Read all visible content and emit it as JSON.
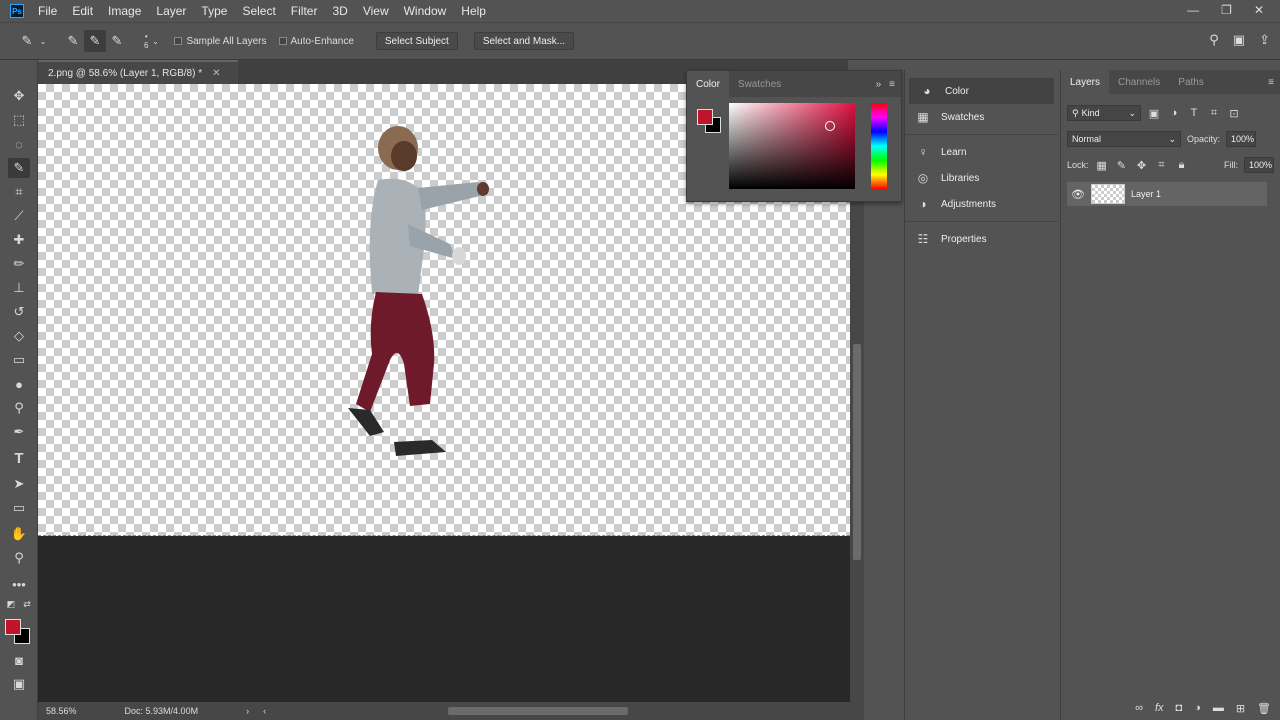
{
  "app": {
    "logo": "Ps"
  },
  "menu": [
    "File",
    "Edit",
    "Image",
    "Layer",
    "Type",
    "Select",
    "Filter",
    "3D",
    "View",
    "Window",
    "Help"
  ],
  "window_controls": [
    "—",
    "❐",
    "✕"
  ],
  "options": {
    "brush_size": "6",
    "sample_all_layers": "Sample All Layers",
    "auto_enhance": "Auto-Enhance",
    "select_subject": "Select Subject",
    "select_and_mask": "Select and Mask..."
  },
  "document": {
    "tab_title": "2.png @ 58.6% (Layer 1, RGB/8) *",
    "zoom": "58.56%",
    "doc_size": "Doc: 5.93M/4.00M"
  },
  "colors": {
    "foreground": "#c0142d",
    "background": "#000000",
    "accent": "#31a8ff"
  },
  "color_panel": {
    "tabs": [
      "Color",
      "Swatches"
    ]
  },
  "side_panels": [
    "Color",
    "Swatches",
    "Learn",
    "Libraries",
    "Adjustments",
    "Properties"
  ],
  "layers_panel": {
    "tabs": [
      "Layers",
      "Channels",
      "Paths"
    ],
    "filter": "Kind",
    "blend_mode": "Normal",
    "opacity_label": "Opacity:",
    "opacity": "100%",
    "lock_label": "Lock:",
    "fill_label": "Fill:",
    "fill": "100%",
    "layers": [
      {
        "name": "Layer 1",
        "visible": true
      }
    ]
  }
}
